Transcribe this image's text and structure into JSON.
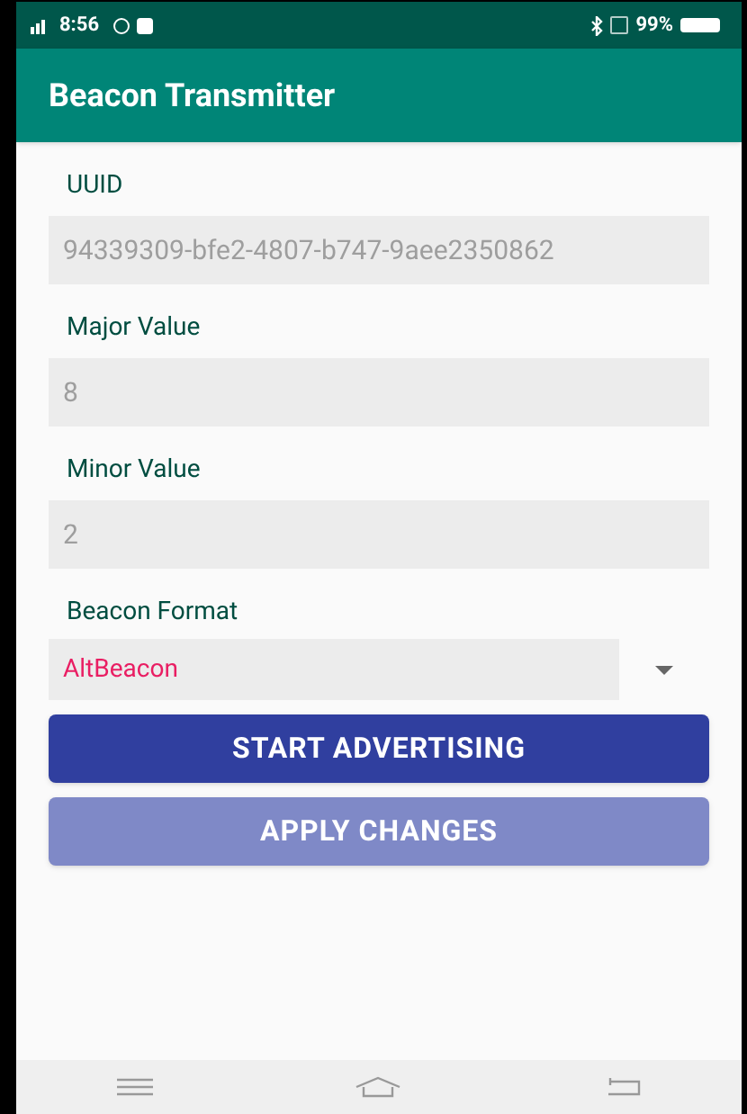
{
  "status_bar": {
    "time": "8:56",
    "battery": "99%"
  },
  "app_bar": {
    "title": "Beacon Transmitter"
  },
  "fields": [
    {
      "label": "UUID",
      "value": "94339309-bfe2-4807-b747-9aee2350862"
    },
    {
      "label": "Major Value",
      "value": "8"
    },
    {
      "label": "Minor Value",
      "value": "2"
    }
  ],
  "beacon_format": {
    "label": "Beacon Format",
    "value": "AltBeacon"
  },
  "buttons": [
    {
      "label": "START ADVERTISING",
      "disabled": false
    },
    {
      "label": "APPLY CHANGES",
      "disabled": true
    }
  ]
}
